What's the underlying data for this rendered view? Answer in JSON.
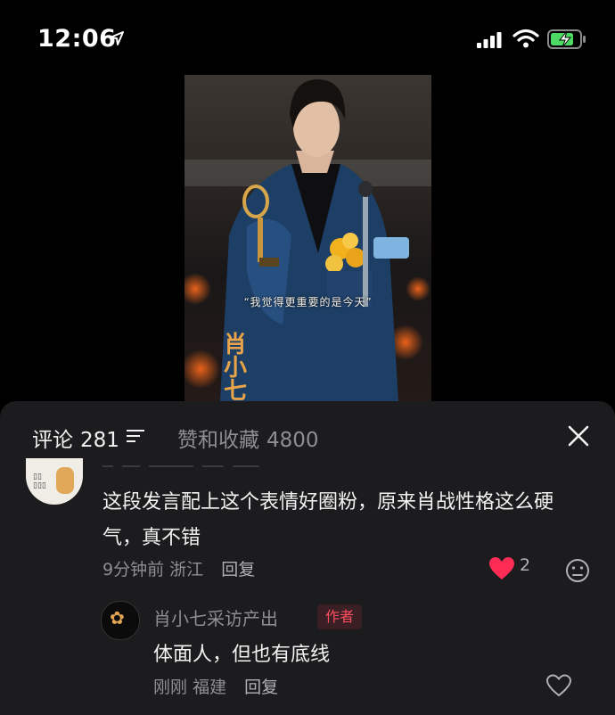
{
  "status_bar": {
    "time": "12:06",
    "icons": [
      "location-arrow-icon",
      "cellular-signal-icon",
      "wifi-icon",
      "battery-charging-icon"
    ]
  },
  "video": {
    "subtitle": "“我觉得更重要的是今天”",
    "watermark": [
      "肖",
      "小",
      "七"
    ]
  },
  "sheet": {
    "comments_tab_label": "评论",
    "comments_count": "281",
    "likes_tab_label": "赞和收藏",
    "likes_count": "4800",
    "comments": [
      {
        "text": "这段发言配上这个表情好圈粉，原来肖战性格这么硬气，真不错",
        "time": "9分钟前",
        "location": "浙江",
        "reply_label": "回复",
        "like_count": "2",
        "replies": [
          {
            "author": "肖小七采访产出",
            "badge": "作者",
            "text": "体面人，但也有底线",
            "time": "刚刚",
            "location": "福建",
            "reply_label": "回复"
          }
        ]
      }
    ]
  },
  "colors": {
    "background": "#000000",
    "sheet": "#1c1c1e",
    "like_red": "#fe2c55",
    "author_badge": "#ff4d5e",
    "battery_green": "#4cd964"
  }
}
